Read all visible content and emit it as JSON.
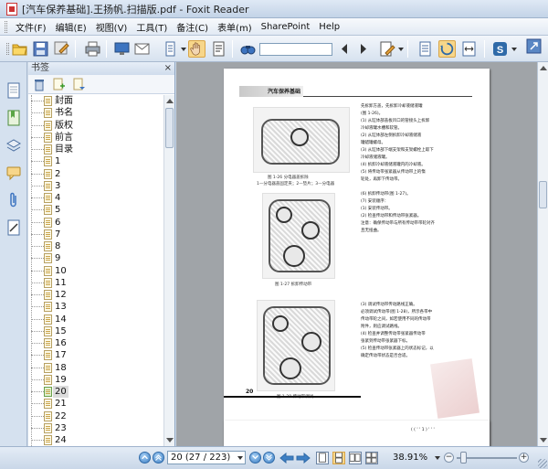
{
  "window": {
    "title": "[汽车保养基础].王扬帆.扫描版.pdf - Foxit Reader"
  },
  "menu": {
    "items": [
      "文件(F)",
      "编辑(E)",
      "视图(V)",
      "工具(T)",
      "备注(C)",
      "表单(m)",
      "SharePoint",
      "Help"
    ]
  },
  "toolbar": {
    "search_value": "",
    "icons": [
      "open-folder-icon",
      "save-icon",
      "print-icon",
      "hand-tool-icon",
      "find-icon"
    ]
  },
  "bookmarks": {
    "header": "书签",
    "close_symbol": "×",
    "items": [
      "封面",
      "书名",
      "版权",
      "前言",
      "目录",
      "1",
      "2",
      "3",
      "4",
      "5",
      "6",
      "7",
      "8",
      "9",
      "10",
      "11",
      "12",
      "13",
      "14",
      "15",
      "16",
      "17",
      "18",
      "19",
      "20",
      "21",
      "22",
      "23",
      "24"
    ],
    "selected_label": "20"
  },
  "document": {
    "header_title": "汽车保养基础",
    "caption_top": "图 1-26  分电器盖拆除",
    "caption_top_sub": "1—分电器盖固定夹；2—垫片；3—分电器",
    "caption_mid": "图 1-27  拆卸传动带",
    "caption_bottom": "图 1-28  传动带调试",
    "right_text_top": [
      "先拆卸方盖，先拆卸冷却液储液罐",
      "(图 1-26)。",
      "(1) 从缸体部盖板凹口的管接头上拆卸",
      "冷却液罐水槽和软管。",
      "(2) 从缸体部左侧拆卸冷却液储液",
      "罐蜡罐螺母。",
      "(3) 从缸体部下端支架和支架螺栓上取下",
      "冷却液储液罐。",
      "(4) 拆卸冷却液储液罐内的冷却液。",
      "(5) 将传动带张紧器从传动带上的惰",
      "轮处，再卸下传动带。",
      "",
      "(6) 拆卸传动带(图 1-27)。",
      "(7) 安装顺序：",
      "(1) 安装传动带。",
      "(2) 检查传动带和传动带张紧器。",
      "注意：确保传动带与所有传动带带轮对齐",
      "且无扭曲。"
    ],
    "right_text_bottom": [
      "(3) 调试传动带传动路线正确。",
      "必须调试传动带(图 1-28)，所示各带中",
      "传动带轮之间，如若使用不同的传动带",
      "附件，则应调试路线。",
      "(4) 检查并调整传动带张紧器传动带",
      "张紧到传动带张紧器下标。",
      "(5) 检查传动带张紧器上的状态标记，以",
      "确定传动带状态是否合适。"
    ],
    "page_number": "20",
    "next_page_snippet": "( ( ' ' 1 ) ' ' '"
  },
  "statusbar": {
    "page_display": "20 (27 / 223)",
    "zoom": "38.91%",
    "zoom_minus": "−",
    "zoom_plus": "+",
    "zoom_level": 0.1
  }
}
